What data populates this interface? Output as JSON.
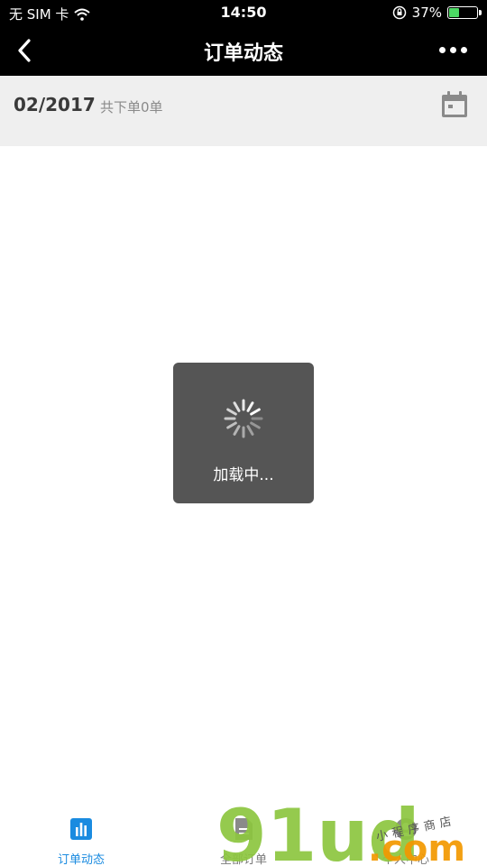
{
  "status_bar": {
    "carrier": "无 SIM 卡",
    "time": "14:50",
    "battery": "37%",
    "battery_level": 0.37
  },
  "nav": {
    "title": "订单动态"
  },
  "header": {
    "month": "02/2017",
    "order_count": "共下单0单"
  },
  "loading": {
    "text": "加载中..."
  },
  "tabs": [
    {
      "label": "订单动态",
      "icon": "bar-chart-icon",
      "active": true
    },
    {
      "label": "全部订单",
      "icon": "document-icon",
      "active": false
    },
    {
      "label": "个人中心",
      "icon": "user-icon",
      "active": false
    }
  ],
  "watermark": {
    "brand": "91ud",
    "domain": ".com",
    "tagline": "小程序商店"
  },
  "colors": {
    "accent": "#1a8be0",
    "bar": "#000000",
    "header_bg": "#efefef",
    "toast_bg": "#4c4c4c",
    "watermark_green": "#8dc63f",
    "watermark_orange": "#f39800"
  }
}
